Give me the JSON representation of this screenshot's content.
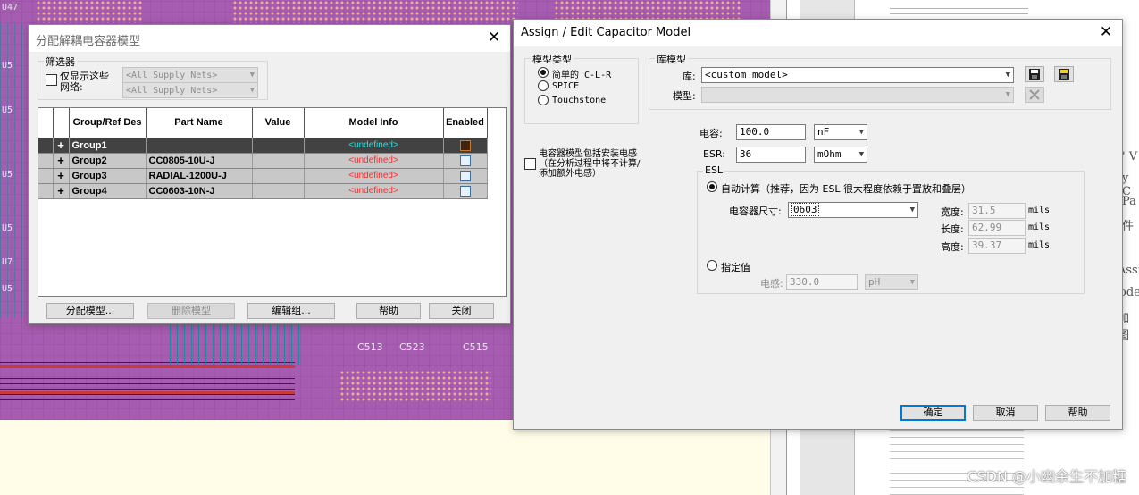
{
  "background": {
    "pcb_labels": [
      "U47",
      "U5",
      "U5",
      "U5",
      "U5",
      "U7",
      "U5"
    ],
    "capacitor_labels": [
      "C513",
      "C523",
      "C515"
    ],
    "doc_fragments": [
      "' V",
      "y C",
      "Pa",
      "件",
      "Assig",
      "ode",
      "加图"
    ],
    "watermark": "CSDN @小幽余生不加糖"
  },
  "decap_dialog": {
    "title": "分配解耦电容器模型",
    "filter": {
      "group_label": "筛选器",
      "checkbox_label": "仅显示这些网络:",
      "supply_nets_1": "<All Supply Nets>",
      "supply_nets_2": "<All Supply Nets>"
    },
    "table": {
      "columns": [
        "Group/Ref Des",
        "Part Name",
        "Value",
        "Model Info",
        "Enabled"
      ],
      "rows": [
        {
          "group": "Group1",
          "part": "",
          "value": "",
          "model": "<undefined>",
          "enabled": false,
          "selected": true
        },
        {
          "group": "Group2",
          "part": "CC0805-10U-J",
          "value": "",
          "model": "<undefined>",
          "enabled": false,
          "selected": false
        },
        {
          "group": "Group3",
          "part": "RADIAL-1200U-J",
          "value": "",
          "model": "<undefined>",
          "enabled": false,
          "selected": false
        },
        {
          "group": "Group4",
          "part": "CC0603-10N-J",
          "value": "",
          "model": "<undefined>",
          "enabled": false,
          "selected": false
        }
      ]
    },
    "buttons": {
      "assign": "分配模型...",
      "delete": "删除模型",
      "edit_group": "编辑组...",
      "help": "帮助",
      "close": "关闭"
    }
  },
  "cap_dialog": {
    "title": "Assign / Edit Capacitor Model",
    "model_type": {
      "label": "模型类型",
      "options": [
        "简单的 C-L-R",
        "SPICE",
        "Touchstone"
      ],
      "selected": 0
    },
    "mount_checkbox": "电容器模型包括安装电感（在分析过程中将不计算/添加额外电感）",
    "library": {
      "group_label": "库模型",
      "lib_label": "库:",
      "lib_value": "<custom model>",
      "model_label": "模型:",
      "model_value": ""
    },
    "capacitance": {
      "label": "电容:",
      "value": "100.0",
      "unit": "nF"
    },
    "esr": {
      "label": "ESR:",
      "value": "36",
      "unit": "mOhm"
    },
    "esl": {
      "group_label": "ESL",
      "auto_label": "自动计算（推荐，因为 ESL 很大程度依赖于置放和叠层）",
      "size_label": "电容器尺寸:",
      "size_value": "0603",
      "width_label": "宽度:",
      "width_value": "31.5",
      "length_label": "长度:",
      "length_value": "62.99",
      "height_label": "高度:",
      "height_value": "39.37",
      "unit": "mils",
      "specify_label": "指定值",
      "inductance_label": "电感:",
      "inductance_value": "330.0",
      "inductance_unit": "pH",
      "mode": "auto"
    },
    "buttons": {
      "ok": "确定",
      "cancel": "取消",
      "help": "帮助"
    }
  }
}
